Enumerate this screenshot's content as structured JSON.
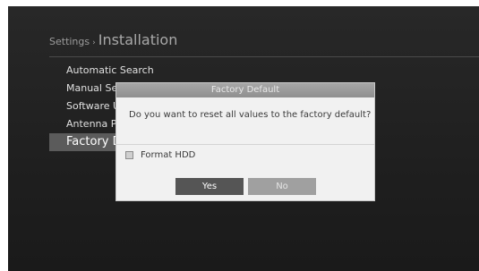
{
  "header": {
    "parent": "Settings",
    "separator": "›",
    "current": "Installation"
  },
  "menu": {
    "items": [
      {
        "label": "Automatic Search"
      },
      {
        "label": "Manual Search"
      },
      {
        "label": "Software Update"
      },
      {
        "label": "Antenna Power"
      },
      {
        "label": "Factory Default"
      }
    ],
    "selected_index": 4
  },
  "dialog": {
    "title": "Factory Default",
    "message": "Do you want to reset all values to the factory default?",
    "checkbox_label": "Format HDD",
    "checkbox_checked": false,
    "yes_label": "Yes",
    "no_label": "No"
  }
}
